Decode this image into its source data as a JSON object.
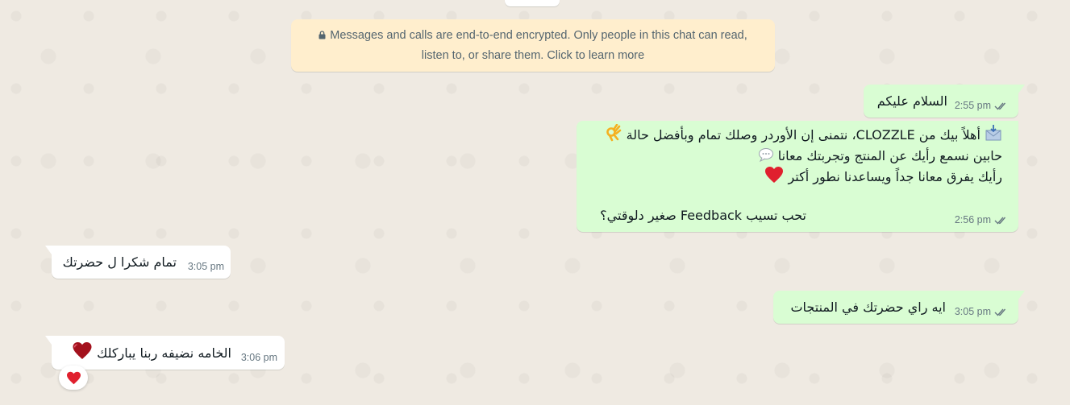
{
  "encryption_notice": {
    "line1": "Messages and calls are end-to-end encrypted. Only people in this chat can read,",
    "line2": "listen to, or share them. Click to learn more"
  },
  "messages": [
    {
      "direction": "outgoing",
      "text": "السلام عليكم",
      "time": "2:55 pm",
      "status": "read"
    },
    {
      "direction": "outgoing",
      "lines": [
        "أهلاً بيك من CLOZZLE، نتمنى إن الأوردر وصلك تمام وبأفضل حالة",
        "حابين نسمع رأيك عن المنتج وتجربتك معانا",
        "رأيك يفرق معانا جداً ويساعدنا نطور أكتر",
        "",
        "تحب تسيب Feedback صغير دلوقتي؟"
      ],
      "emojis": [
        "envelope-with-arrow",
        "ok-hand",
        "speech-balloon",
        "red-heart"
      ],
      "time": "2:56 pm",
      "status": "read"
    },
    {
      "direction": "incoming",
      "text": "تمام شكرا ل حضرتك",
      "time": "3:05 pm"
    },
    {
      "direction": "outgoing",
      "text": "ايه راي حضرتك في المنتجات",
      "time": "3:05 pm",
      "status": "read"
    },
    {
      "direction": "incoming",
      "text": "الخامه نضيفه ربنا يباركلك",
      "emoji": "red-heart",
      "time": "3:06 pm",
      "reaction": "red-heart"
    }
  ],
  "colors": {
    "outgoing_bubble": "#d9fdd3",
    "incoming_bubble": "#ffffff",
    "notice_bg": "#ffeecd",
    "chat_bg": "#efeae2",
    "read_ticks": "#667781"
  }
}
